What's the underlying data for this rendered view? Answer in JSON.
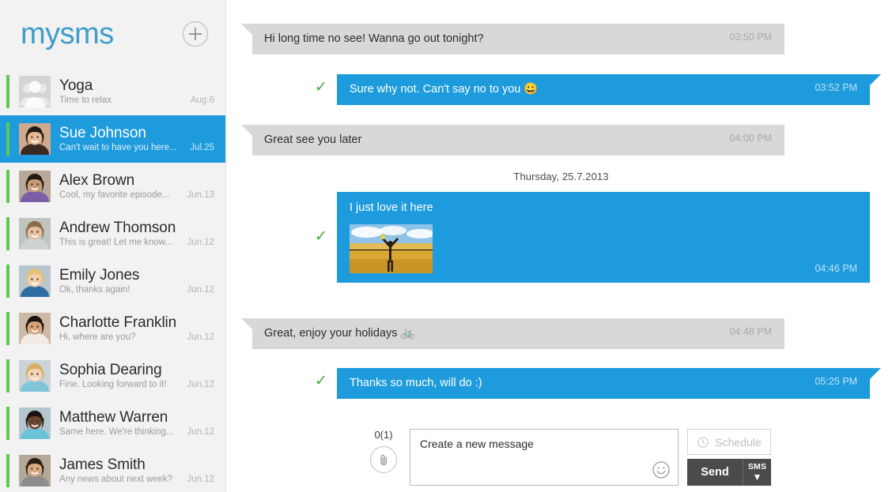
{
  "app": {
    "logo": "mysms",
    "new_conversation_icon": "plus-circle-icon",
    "accent_blue": "#1e9bdd",
    "logo_blue": "#3f9ccb",
    "accent_green": "#5ec94a",
    "check_green": "#3faa3f",
    "incoming_bubble": "#d8d8d8",
    "sidebar_bg": "#f2f2f2",
    "button_dark": "#4b4b4b"
  },
  "sidebar": {
    "conversations": [
      {
        "name": "Yoga",
        "preview": "Time to relax",
        "date": "Aug.6",
        "avatar": "group",
        "selected": false
      },
      {
        "name": "Sue Johnson",
        "preview": "Can't wait to have you here...",
        "date": "Jul.25",
        "avatar": "woman-dark-hair",
        "selected": true
      },
      {
        "name": "Alex Brown",
        "preview": "Cool, my favorite episode...",
        "date": "Jun.13",
        "avatar": "man-purple-shirt",
        "selected": false
      },
      {
        "name": "Andrew Thomson",
        "preview": "This is great! Let me know...",
        "date": "Jun.12",
        "avatar": "man-short-hair",
        "selected": false
      },
      {
        "name": "Emily Jones",
        "preview": "Ok, thanks again!",
        "date": "Jun.12",
        "avatar": "woman-blonde",
        "selected": false
      },
      {
        "name": "Charlotte Franklin",
        "preview": "Hi, where are you?",
        "date": "Jun.12",
        "avatar": "woman-dark-hair-2",
        "selected": false
      },
      {
        "name": "Sophia Dearing",
        "preview": "Fine. Looking forward to it!",
        "date": "Jun.12",
        "avatar": "woman-blonde-2",
        "selected": false
      },
      {
        "name": "Matthew Warren",
        "preview": "Same here. We're thinking...",
        "date": "Jun.12",
        "avatar": "man-dark-skin",
        "selected": false
      },
      {
        "name": "James Smith",
        "preview": "Any news about next week?",
        "date": "Jun.12",
        "avatar": "man-beard",
        "selected": false
      }
    ]
  },
  "thread": {
    "date_separator": "Thursday, 25.7.2013",
    "messages": [
      {
        "kind": "text",
        "direction": "in",
        "text": "Hi long time no see! Wanna go out tonight?",
        "time": "03:50 PM",
        "delivered": false
      },
      {
        "kind": "text",
        "direction": "out",
        "text": "Sure why not. Can't say no to you 😀",
        "time": "03:52 PM",
        "delivered": true
      },
      {
        "kind": "text",
        "direction": "in",
        "text": "Great see you later",
        "time": "04:00 PM",
        "delivered": false
      },
      {
        "kind": "photo",
        "direction": "out",
        "text": "I just love it here",
        "time": "04:46 PM",
        "delivered": true,
        "photo_alt": "person with raised arms in a wheat field under blue sky"
      },
      {
        "kind": "text",
        "direction": "in",
        "text": "Great, enjoy your holidays 🚲",
        "time": "04:48 PM",
        "delivered": false
      },
      {
        "kind": "text",
        "direction": "out",
        "text": "Thanks so much, will do :)",
        "time": "05:25 PM",
        "delivered": true
      }
    ]
  },
  "composer": {
    "char_counter": "0(1)",
    "attach_icon": "paperclip-icon",
    "message_placeholder": "Create a new message",
    "smiley_icon": "smiley-face-icon",
    "schedule_label": "Schedule",
    "schedule_icon": "clock-icon",
    "send_label": "Send",
    "sms_label": "SMS",
    "sms_chevron_icon": "chevron-down-icon"
  }
}
